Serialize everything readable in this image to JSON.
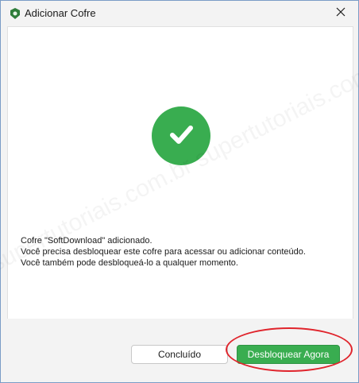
{
  "window": {
    "title": "Adicionar Cofre",
    "icon": "vault-app-icon",
    "close_icon": "close-icon"
  },
  "content": {
    "status_icon": "checkmark-icon",
    "status_color": "#39ad50",
    "lines": [
      "Cofre \"SoftDownload\" adicionado.",
      "Você precisa desbloquear este cofre para acessar ou adicionar conteúdo.",
      "Você também pode desbloqueá-lo a qualquer momento."
    ]
  },
  "buttons": {
    "done_label": "Concluído",
    "unlock_label": "Desbloquear Agora"
  },
  "watermark": "supertutoriais.com.br supertutoriais.com.br"
}
